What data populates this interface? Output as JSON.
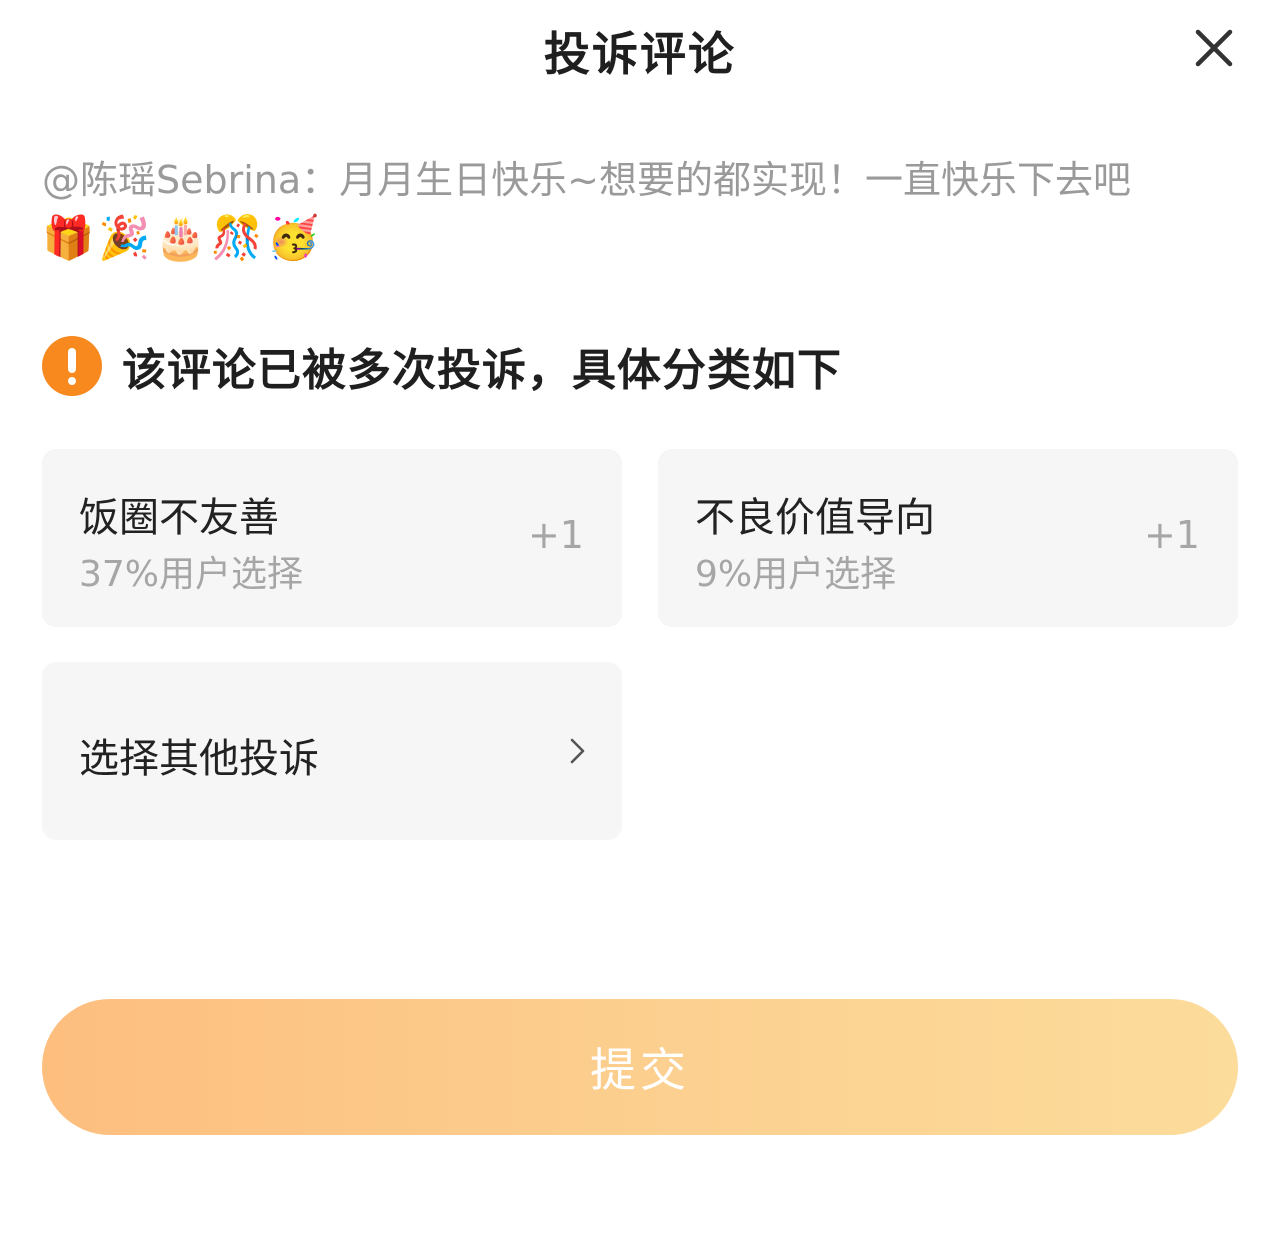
{
  "header": {
    "title": "投诉评论",
    "close_icon": "close-icon"
  },
  "comment": {
    "text": "@陈瑶Sebrina：月月生日快乐~想要的都实现！一直快乐下去吧",
    "emojis": "🎁🎉🎂🎊🥳"
  },
  "notice": {
    "icon": "exclamation-circle-icon",
    "text": "该评论已被多次投诉，具体分类如下",
    "accent_color": "#f7891f"
  },
  "options": [
    {
      "label": "饭圈不友善",
      "percent_text": "37%用户选择",
      "count": "+1"
    },
    {
      "label": "不良价值导向",
      "percent_text": "9%用户选择",
      "count": "+1"
    }
  ],
  "other_option": {
    "label": "选择其他投诉",
    "icon": "chevron-right-icon"
  },
  "submit": {
    "label": "提交",
    "gradient_start": "#fdbe7e",
    "gradient_end": "#fcdc9b"
  }
}
